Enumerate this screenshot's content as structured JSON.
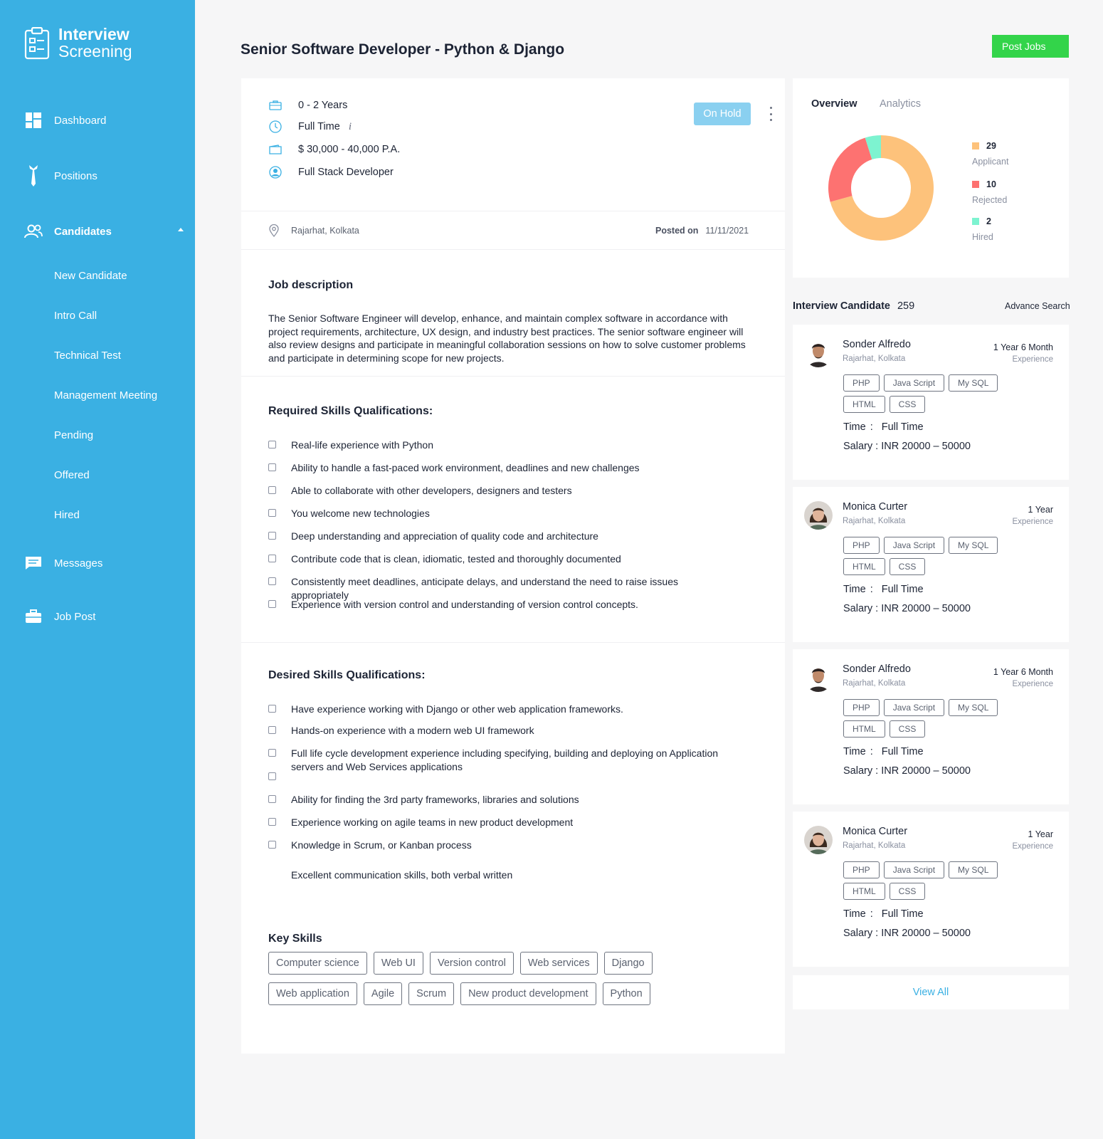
{
  "app": {
    "title_line1": "Interview",
    "title_line2": "Screening"
  },
  "sidebar": {
    "items": [
      {
        "label": "Dashboard"
      },
      {
        "label": "Positions"
      },
      {
        "label": "Candidates"
      },
      {
        "label": "Messages"
      },
      {
        "label": "Job Post"
      }
    ],
    "candidate_subitems": [
      "New Candidate",
      "Intro Call",
      "Technical Test",
      "Management Meeting",
      "Pending",
      "Offered",
      "Hired"
    ]
  },
  "header": {
    "title": "Senior Software Developer - Python & Django",
    "post_jobs_label": "Post Jobs"
  },
  "job": {
    "experience": "0 - 2 Years",
    "type": "Full Time",
    "info_glyph": "i",
    "salary": "$ 30,000 - 40,000 P.A.",
    "role": "Full Stack Developer",
    "status": "On Hold",
    "location": "Rajarhat, Kolkata",
    "posted_label": "Posted on",
    "posted_date": "11/11/2021",
    "description_title": "Job description",
    "description": "The Senior Software Engineer will develop, enhance, and maintain complex software in accordance with project requirements, architecture, UX design, and industry best practices. The senior software engineer will also review designs and participate in meaningful collaboration sessions on how to solve customer problems and participate in determining scope for new projects.",
    "required_title": "Required Skills Qualifications:",
    "required": [
      "Real-life experience with Python",
      "Ability to handle a fast-paced work environment, deadlines and new challenges",
      "Able to collaborate with other developers, designers and testers",
      "You welcome new technologies",
      "Deep understanding and appreciation of quality code and architecture",
      "Contribute code that is clean, idiomatic, tested and thoroughly documented",
      "Consistently meet deadlines, anticipate delays, and understand the need to raise issues appropriately",
      "Experience with version control and understanding of version control concepts."
    ],
    "desired_title": "Desired Skills Qualifications:",
    "desired": [
      "Have experience working with Django or other web application frameworks.",
      "Hands-on experience with a modern web UI framework",
      "Full life cycle development experience including specifying, building and deploying on Application servers and Web Services applications",
      "",
      "Ability for finding the 3rd party frameworks, libraries and solutions",
      "Experience working on agile teams in new product development",
      "Knowledge in Scrum, or Kanban process"
    ],
    "desired_extra": "Excellent communication skills, both verbal written",
    "key_skills_title": "Key Skills",
    "key_skills": [
      "Computer science",
      "Web UI",
      "Version control",
      "Web services",
      "Django",
      "Web application",
      "Agile",
      "Scrum",
      "New product development",
      "Python"
    ]
  },
  "overview": {
    "tab_overview": "Overview",
    "tab_analytics": "Analytics",
    "legend": [
      {
        "count": "29",
        "label": "Applicant",
        "color": "#fdc27b"
      },
      {
        "count": "10",
        "label": "Rejected",
        "color": "#fd7271"
      },
      {
        "count": "2",
        "label": "Hired",
        "color": "#7df3d0"
      }
    ]
  },
  "chart_data": {
    "type": "pie",
    "categories": [
      "Applicant",
      "Rejected",
      "Hired"
    ],
    "values": [
      29,
      10,
      2
    ],
    "colors": [
      "#fdc27b",
      "#fd7271",
      "#7df3d0"
    ],
    "donut": true
  },
  "candidates": {
    "title": "Interview Candidate",
    "count": "259",
    "advance_search": "Advance Search",
    "time_label": "Time",
    "colon": ":",
    "salary_label": "Salary",
    "list": [
      {
        "name": "Sonder Alfredo",
        "location": "Rajarhat, Kolkata",
        "experience": "1 Year 6 Month",
        "experience_label": "Experience",
        "tags": [
          "PHP",
          "Java Script",
          "My SQL",
          "HTML",
          "CSS"
        ],
        "time": "Full Time",
        "salary": ": INR 20000 – 50000"
      },
      {
        "name": "Monica Curter",
        "location": "Rajarhat, Kolkata",
        "experience": "1 Year",
        "experience_label": "Experience",
        "tags": [
          "PHP",
          "Java Script",
          "My SQL",
          "HTML",
          "CSS"
        ],
        "time": "Full Time",
        "salary": ": INR 20000 – 50000"
      },
      {
        "name": "Sonder Alfredo",
        "location": "Rajarhat, Kolkata",
        "experience": "1 Year 6 Month",
        "experience_label": "Experience",
        "tags": [
          "PHP",
          "Java Script",
          "My SQL",
          "HTML",
          "CSS"
        ],
        "time": "Full Time",
        "salary": ": INR 20000 – 50000"
      },
      {
        "name": "Monica Curter",
        "location": "Rajarhat, Kolkata",
        "experience": "1 Year",
        "experience_label": "Experience",
        "tags": [
          "PHP",
          "Java Script",
          "My SQL",
          "HTML",
          "CSS"
        ],
        "time": "Full Time",
        "salary": ": INR 20000 – 50000"
      }
    ],
    "view_all": "View All"
  }
}
